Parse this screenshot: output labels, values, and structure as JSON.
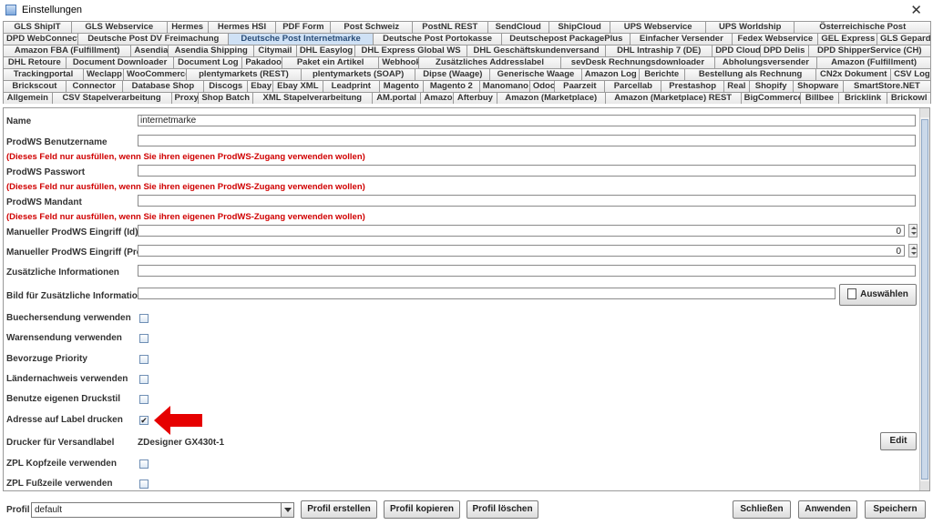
{
  "window": {
    "title": "Einstellungen",
    "close_glyph": "✕",
    "app_icon": "settings-window-icon"
  },
  "tabs": {
    "rows": [
      [
        "GLS ShipIT",
        "GLS Webservice",
        "Hermes",
        "Hermes HSI",
        "PDF Form",
        "Post Schweiz",
        "PostNL REST",
        "SendCloud",
        "ShipCloud",
        "UPS Webservice",
        "UPS Worldship",
        "Österreichische Post"
      ],
      [
        "DPD WebConnect",
        "Deutsche Post DV Freimachung",
        "Deutsche Post Internetmarke",
        "Deutsche Post Portokasse",
        "Deutschepost PackagePlus",
        "Einfacher Versender",
        "Fedex Webservice",
        "GEL Express",
        "GLS Gepard"
      ],
      [
        "Amazon FBA (Fulfillment)",
        "Asendia",
        "Asendia Shipping",
        "Citymail",
        "DHL Easylog",
        "DHL Express Global WS",
        "DHL Geschäftskundenversand",
        "DHL Intraship 7 (DE)",
        "DPD Cloud",
        "DPD Delis",
        "DPD ShipperService (CH)"
      ],
      [
        "DHL Retoure",
        "Document Downloader",
        "Document Log",
        "Pakadoo",
        "Paket ein Artikel",
        "Webhook",
        "Zusätzliches Addresslabel",
        "sevDesk Rechnungsdownloader",
        "Abholungsversender",
        "Amazon (Fulfillment)"
      ],
      [
        "Trackingportal",
        "Weclapp",
        "WooCommerce",
        "plentymarkets (REST)",
        "plentymarkets (SOAP)",
        "Dipse (Waage)",
        "Generische Waage",
        "Amazon Log",
        "Berichte",
        "Bestellung als Rechnung",
        "CN2x Dokument",
        "CSV Log"
      ],
      [
        "Brickscout",
        "Connector",
        "Database Shop",
        "Discogs",
        "Ebay",
        "Ebay XML",
        "Leadprint",
        "Magento",
        "Magento 2",
        "Manomano",
        "Odoo",
        "Paarzeit",
        "Parcellab",
        "Prestashop",
        "Real",
        "Shopify",
        "Shopware",
        "SmartStore.NET"
      ],
      [
        "Allgemein",
        "CSV Stapelverarbeitung",
        "Proxy",
        "Shop Batch",
        "XML Stapelverarbeitung",
        "AM.portal",
        "Amazon",
        "Afterbuy",
        "Amazon (Marketplace)",
        "Amazon (Marketplace) REST",
        "BigCommerce",
        "Billbee",
        "Bricklink",
        "Brickowl"
      ]
    ],
    "active": "Deutsche Post Internetmarke"
  },
  "form": {
    "name_label": "Name",
    "name_value": "internetmarke",
    "user_label": "ProdWS Benutzername",
    "user_value": "",
    "hint_text": "(Dieses Feld nur ausfüllen, wenn Sie ihren eigenen ProdWS-Zugang verwenden wollen)",
    "password_label": "ProdWS Passwort",
    "password_value": "",
    "mandant_label": "ProdWS Mandant",
    "mandant_value": "",
    "manual_id_label": "Manueller ProdWS Eingriff (Id) *",
    "manual_id_value": "0",
    "manual_price_label": "Manueller ProdWS Eingriff (Preis)",
    "manual_price_value": "0",
    "extra_info_label": "Zusätzliche Informationen",
    "extra_info_value": "",
    "image_label": "Bild für Zusätzliche Informationen",
    "image_value": "",
    "choose_button": "Auswählen",
    "checkboxes": [
      {
        "label": "Buechersendung verwenden",
        "checked": false
      },
      {
        "label": "Warensendung verwenden",
        "checked": false
      },
      {
        "label": "Bevorzuge Priority",
        "checked": false
      },
      {
        "label": "Ländernachweis verwenden",
        "checked": false
      },
      {
        "label": "Benutze eigenen Druckstil",
        "checked": false
      },
      {
        "label": "Adresse auf Label drucken",
        "checked": true
      }
    ],
    "printer_label": "Drucker für Versandlabel",
    "printer_value": "ZDesigner GX430t-1",
    "edit_button": "Edit",
    "zpl_header_label": "ZPL Kopfzeile verwenden",
    "zpl_footer_label": "ZPL Fußzeile verwenden",
    "check_glyph": "✔"
  },
  "bottom": {
    "profile_label": "Profil",
    "profile_value": "default",
    "create_button": "Profil erstellen",
    "copy_button": "Profil kopieren",
    "delete_button": "Profil löschen",
    "close_button": "Schließen",
    "apply_button": "Anwenden",
    "save_button": "Speichern"
  },
  "colors": {
    "active_tab": "#cfe1f5",
    "hint": "#d00000",
    "arrow": "#e60000"
  }
}
